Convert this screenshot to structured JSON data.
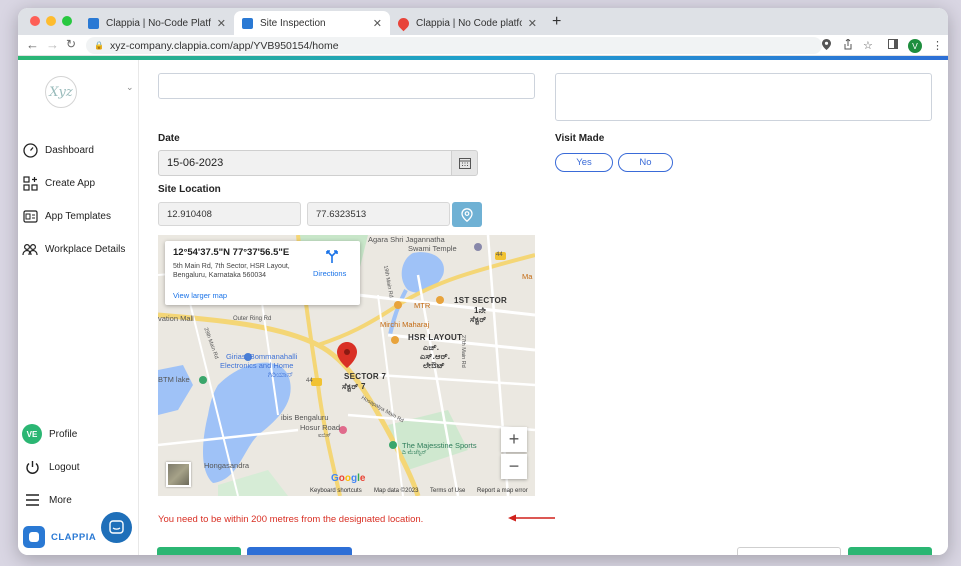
{
  "browser": {
    "tabs": [
      {
        "title": "Clappia | No-Code Platform for",
        "favicon_color": "#2a79d4"
      },
      {
        "title": "Site Inspection",
        "favicon_color": "#2a79d4",
        "active": true
      },
      {
        "title": "Clappia | No Code platform for",
        "favicon_color": "#e8443a"
      }
    ],
    "url": "xyz-company.clappia.com/app/YVB950154/home",
    "profile_initial": "V"
  },
  "sidebar": {
    "logo_text": "Xyz",
    "items": [
      {
        "label": "Dashboard",
        "icon": "dashboard-gauge-icon"
      },
      {
        "label": "Create App",
        "icon": "create-app-grid-icon"
      },
      {
        "label": "App Templates",
        "icon": "templates-icon"
      },
      {
        "label": "Workplace Details",
        "icon": "workplace-people-icon"
      }
    ],
    "profile": {
      "initials": "VE",
      "label": "Profile"
    },
    "logout_label": "Logout",
    "more_label": "More",
    "brand": "CLAPPIA"
  },
  "form": {
    "date_label": "Date",
    "date_value": "15-06-2023",
    "visit_made_label": "Visit Made",
    "visit_options": [
      "Yes",
      "No"
    ],
    "site_location_label": "Site Location",
    "latitude": "12.910408",
    "longitude": "77.6323513",
    "error_message": "You need to be within 200 metres from the designated location."
  },
  "map": {
    "card_title": "12°54'37.5\"N 77°37'56.5\"E",
    "card_address": "5th Main Rd, 7th Sector, HSR Layout, Bengaluru, Karnataka 560034",
    "directions_label": "Directions",
    "view_larger": "View larger map",
    "labels": {
      "agara": "Agara Shri Jagannatha",
      "swami": "Swami Temple",
      "sector1": "1ST SECTOR",
      "sector1_kn": "1ನೇ",
      "sector1_kn2": "ಸೆಕ್ಟರ್",
      "mtr": "MTR",
      "mirchi": "Mirchi Maharaj",
      "hsr": "HSR LAYOUT",
      "hsr_kn1": "ಎಚ್.",
      "hsr_kn2": "ಎಸ್.ಆರ್.",
      "hsr_kn3": "ಲೇಔಟ್",
      "sector7": "SECTOR 7",
      "sector7_kn": "ಸೆಕ್ಟರ್ 7",
      "vation_mall": "vation Mall",
      "outer_ring": "Outer Ring Rd",
      "girias1": "Girias, Bommanahalli",
      "girias2": "Electronics and Home",
      "girias_kn": "ಗಿರಿಯಾಸ್",
      "btm": "BTM lake",
      "ibis1": "ibis Bengaluru",
      "ibis2": "Hosur Road",
      "ibis_kn": "ಐಬಿಸ್",
      "majestine1": "The Majesstine Sports",
      "majestine_kn": "ದಿ ಮೆಜೆಸ್ಟಿನ್",
      "hongasandra": "Hongasandra",
      "road_44a": "44",
      "road_44b": "44",
      "ma": "Ma",
      "road_29th": "29th Main Rd",
      "road_19th": "19th Main Rd",
      "road_hosapalya": "Hosapalya Main Rd",
      "road_27th": "27th Main Rd"
    },
    "zoom_in": "+",
    "zoom_out": "−",
    "google": "Google",
    "footer": {
      "shortcuts": "Keyboard shortcuts",
      "mapdata": "Map data ©2023",
      "terms": "Terms of Use",
      "report": "Report a map error"
    }
  }
}
